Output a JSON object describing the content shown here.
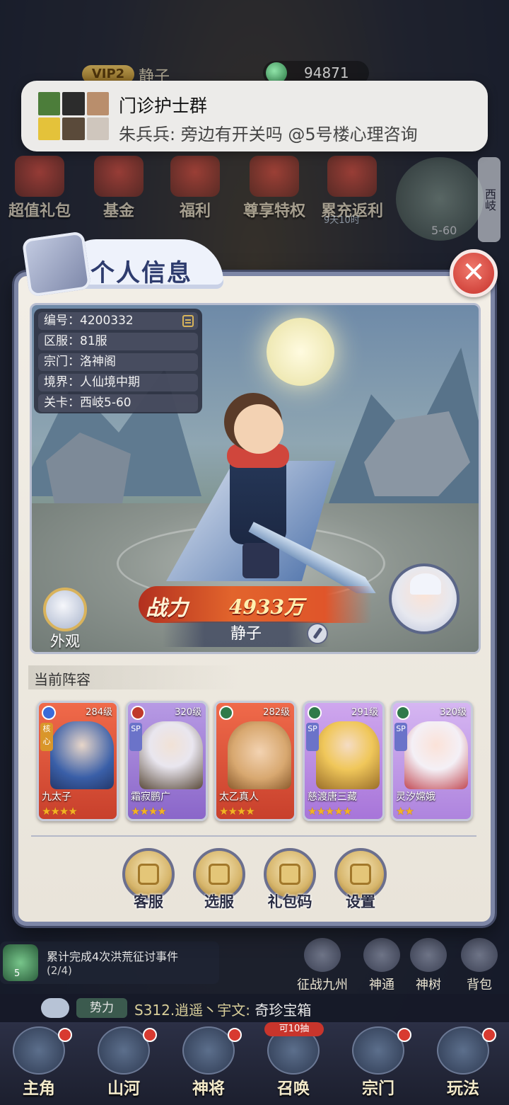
{
  "topbar": {
    "vip": "VIP2",
    "player_name": "静子",
    "currency": "94871"
  },
  "notification": {
    "title": "门诊护士群",
    "message": "朱兵兵: 旁边有开关吗 @5号楼心理咨询"
  },
  "menu": {
    "items": [
      "超值礼包",
      "基金",
      "福利",
      "尊享特权",
      "累充返利"
    ],
    "timer": "9天10时",
    "map_stage": "5-60",
    "region": "西岐"
  },
  "panel": {
    "title": "个人信息",
    "close": "✕",
    "info": [
      {
        "label": "编号",
        "value": "4200332"
      },
      {
        "label": "区服",
        "value": "81服"
      },
      {
        "label": "宗门",
        "value": "洛神阁"
      },
      {
        "label": "境界",
        "value": "人仙境中期"
      },
      {
        "label": "关卡",
        "value": "西岐5-60"
      }
    ],
    "info_text": [
      "编号：4200332",
      "区服：81服",
      "宗门：洛神阁",
      "境界：人仙境中期",
      "关卡：西岐5-60"
    ],
    "power_label": "战力",
    "power_value": "4933万",
    "character_name": "静子",
    "appearance_label": "外观",
    "team_title": "当前阵容",
    "team": [
      {
        "name": "九太子",
        "level": "284级",
        "tag": "核心",
        "stars": "★★★★"
      },
      {
        "name": "霜寂鹏广",
        "level": "320级",
        "tag": "SP",
        "stars": "★★★★"
      },
      {
        "name": "太乙真人",
        "level": "282级",
        "tag": "",
        "stars": "★★★★"
      },
      {
        "name": "慈渡唐三藏",
        "level": "291级",
        "tag": "SP",
        "stars": "★★★★★"
      },
      {
        "name": "灵汐嫦娥",
        "level": "320级",
        "tag": "SP",
        "stars": "★★"
      }
    ],
    "actions": [
      "客服",
      "选服",
      "礼包码",
      "设置"
    ]
  },
  "quest": {
    "text": "累计完成4次洪荒征讨事件",
    "progress": "(2/4)",
    "badge": "5"
  },
  "side_nav": [
    "征战九州",
    "神通",
    "神树",
    "背包"
  ],
  "chat": {
    "channel": "势力",
    "sender": "S312.逍遥丶宇文:",
    "content": "奇珍宝箱"
  },
  "bottom_nav": [
    {
      "label": "主角"
    },
    {
      "label": "山河"
    },
    {
      "label": "神将"
    },
    {
      "label": "召唤",
      "pill": "可10抽"
    },
    {
      "label": "宗门"
    },
    {
      "label": "玩法"
    }
  ]
}
